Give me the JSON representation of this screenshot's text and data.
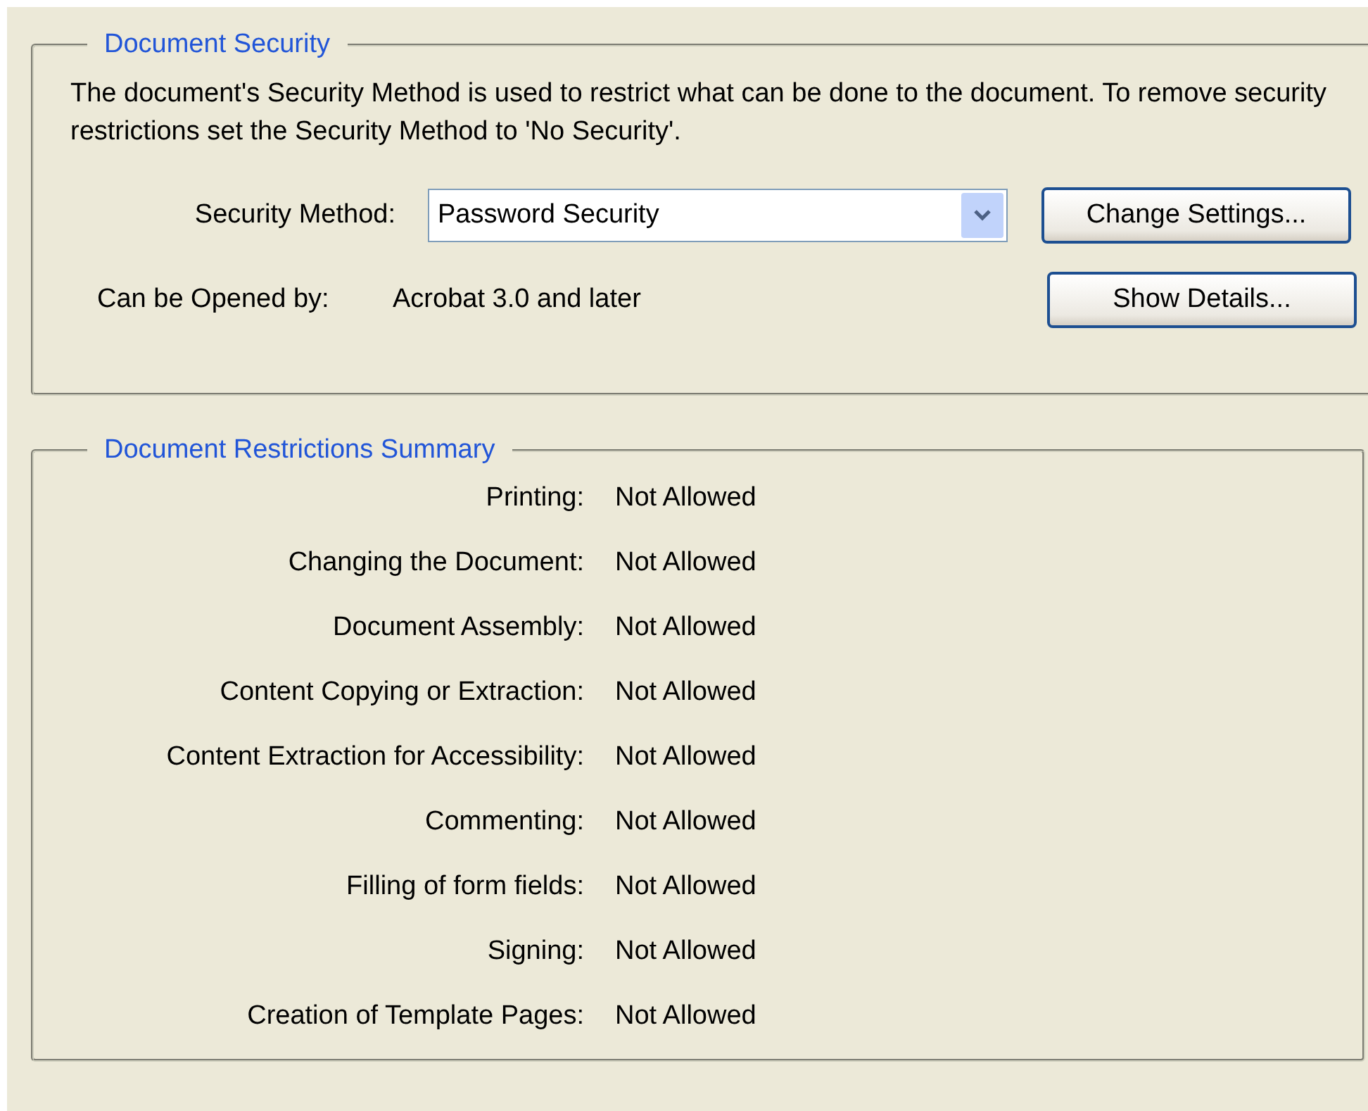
{
  "security": {
    "title": "Document Security",
    "description": "The document's Security Method is used to restrict what can be done to the document. To remove security restrictions set the Security Method to 'No Security'.",
    "method_label": "Security Method:",
    "method_value": "Password Security",
    "change_button": "Change Settings...",
    "opened_label": "Can be Opened by:",
    "opened_value": "Acrobat 3.0 and later",
    "details_button": "Show Details..."
  },
  "restrictions": {
    "title": "Document Restrictions Summary",
    "rows": [
      {
        "label": "Printing:",
        "value": "Not Allowed"
      },
      {
        "label": "Changing the Document:",
        "value": "Not Allowed"
      },
      {
        "label": "Document Assembly:",
        "value": "Not Allowed"
      },
      {
        "label": "Content Copying or Extraction:",
        "value": "Not Allowed"
      },
      {
        "label": "Content Extraction for Accessibility:",
        "value": "Not Allowed"
      },
      {
        "label": "Commenting:",
        "value": "Not Allowed"
      },
      {
        "label": "Filling of form fields:",
        "value": "Not Allowed"
      },
      {
        "label": "Signing:",
        "value": "Not Allowed"
      },
      {
        "label": "Creation of Template Pages:",
        "value": "Not Allowed"
      }
    ]
  }
}
